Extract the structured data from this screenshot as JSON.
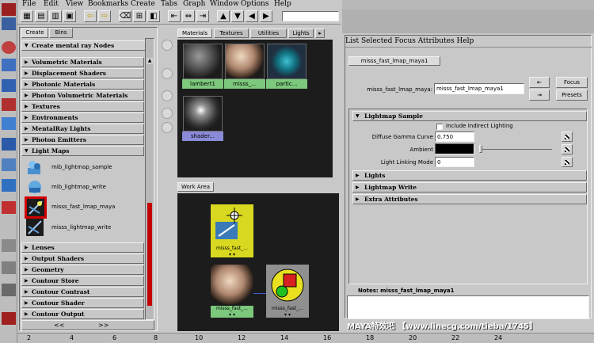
{
  "menubar": {
    "items": [
      "File",
      "Edit",
      "View",
      "Bookmarks",
      "Create",
      "Tabs",
      "Graph",
      "Window",
      "Options",
      "Help"
    ]
  },
  "create_bar": {
    "tabs": [
      "Create",
      "Bins"
    ],
    "header": "Create mental ray Nodes",
    "categories_top": [
      "Volumetric Materials",
      "Displacement Shaders",
      "Photonic Materials",
      "Photon Volumetric Materials",
      "Textures",
      "Environments",
      "MentalRay Lights",
      "Photon Emitters",
      "Light Maps"
    ],
    "light_map_nodes": [
      "mib_lightmap_sample",
      "mib_lightmap_write",
      "misss_fast_lmap_maya",
      "misss_lightmap_write"
    ],
    "categories_bottom": [
      "Lenses",
      "Output Shaders",
      "Geometry",
      "Contour Store",
      "Contour Contrast",
      "Contour Shader",
      "Contour Output"
    ],
    "bottom_arrows": [
      "<<",
      ">>"
    ]
  },
  "materials_panel": {
    "tabs": [
      "Materials",
      "Textures",
      "Utilities",
      "Lights"
    ],
    "swatches": [
      "lambert1",
      "misss_...",
      "partic...",
      "shader..."
    ]
  },
  "work_area": {
    "tab": "Work Area",
    "nodes": [
      "misss_fast_...",
      "misss_fast_...",
      "misss_fast_..."
    ]
  },
  "attribute_editor": {
    "menubar": "List  Selected  Focus  Attributes  Help",
    "tab": "misss_fast_lmap_maya1",
    "node_label": "misss_fast_lmap_maya:",
    "node_value": "misss_fast_lmap_maya1",
    "focus_button": "Focus",
    "presets_button": "Presets",
    "section_lightmap_sample": "Lightmap Sample",
    "include_indirect": "Include Indirect Lighting",
    "diffuse_gamma_label": "Diffuse Gamma Curve",
    "diffuse_gamma_value": "0.750",
    "ambient_label": "Ambient",
    "light_linking_label": "Light Linking Mode",
    "light_linking_value": "0",
    "sections_collapsed": [
      "Lights",
      "Lightmap Write",
      "Extra Attributes"
    ],
    "notes_label": "Notes:  misss_fast_lmap_maya1"
  },
  "timeline": {
    "ticks": [
      "2",
      "4",
      "6",
      "8",
      "10",
      "12",
      "14",
      "16",
      "18",
      "20",
      "22",
      "24"
    ]
  },
  "watermark": "MAYA特效吧 【www.linecg.com/tieba/1745】",
  "colors": {
    "accent_red": "#c40000",
    "swatch_label_green": "#7cc87c",
    "node_yellow": "#d8d820",
    "dark_area": "#1c1c1c"
  }
}
